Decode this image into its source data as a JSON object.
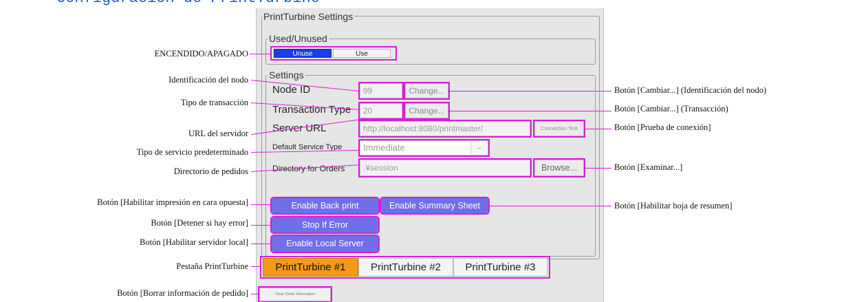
{
  "page_heading": "Configuración de PrintTurbine",
  "panel": {
    "title": "PrintTurbine Settings",
    "used_unused": {
      "legend": "Used/Unused",
      "unuse_label": "Unuse",
      "use_label": "Use",
      "selected": "Unuse"
    },
    "settings": {
      "legend": "Settings",
      "node_id": {
        "label": "Node ID",
        "value": "99",
        "change_label": "Change..."
      },
      "transaction_type": {
        "label": "Transaction Type",
        "value": "20",
        "change_label": "Change..."
      },
      "server_url": {
        "label": "Server URL",
        "value": "http://localhost:8080/printmaster/",
        "test_label": "Connection Test"
      },
      "default_service_type": {
        "label": "Default Service Type",
        "value": "Immediate"
      },
      "directory_for_orders": {
        "label": "Directory for Orders",
        "value": ".¥session",
        "browse_label": "Browse..."
      },
      "enable_back_print": "Enable Back print",
      "enable_summary_sheet": "Enable Summary Sheet",
      "stop_if_error": "Stop If Error",
      "enable_local_server": "Enable Local Server"
    },
    "tabs": [
      {
        "label": "PrintTurbine #1",
        "active": true
      },
      {
        "label": "PrintTurbine #2",
        "active": false
      },
      {
        "label": "PrintTurbine #3",
        "active": false
      }
    ],
    "clear_order_label": "Clear Order Information"
  },
  "annotations": {
    "left": {
      "on_off": "ENCENDIDO/APAGADO",
      "node_id": "Identificación del nodo",
      "transaction_type": "Tipo de transacción",
      "server_url": "URL del servidor",
      "default_service": "Tipo de servicio predeterminado",
      "orders_dir": "Directorio de pedidos",
      "back_print": "Botón [Habilitar impresión en cara opuesta]",
      "stop_error": "Botón [Detener si hay error]",
      "local_server": "Botón [Habilitar servidor local]",
      "tab": "Pestaña PrintTurbine",
      "clear_order": "Botón [Borrar información de pedido]"
    },
    "right": {
      "change_node": "Botón [Cambiar...] (Identificación del nodo)",
      "change_transaction": "Botón [Cambiar...] (Transacción)",
      "connection_test": "Botón [Prueba de conexión]",
      "browse": "Botón [Examinar...]",
      "summary_sheet": "Botón [Habilitar hoja de resumen]"
    }
  },
  "colors": {
    "highlight": "#d81dd8",
    "purple_button": "#6f6fe8",
    "active_toggle": "#1a3ee6",
    "active_tab": "#f39b18",
    "heading": "#1f5fbf"
  }
}
